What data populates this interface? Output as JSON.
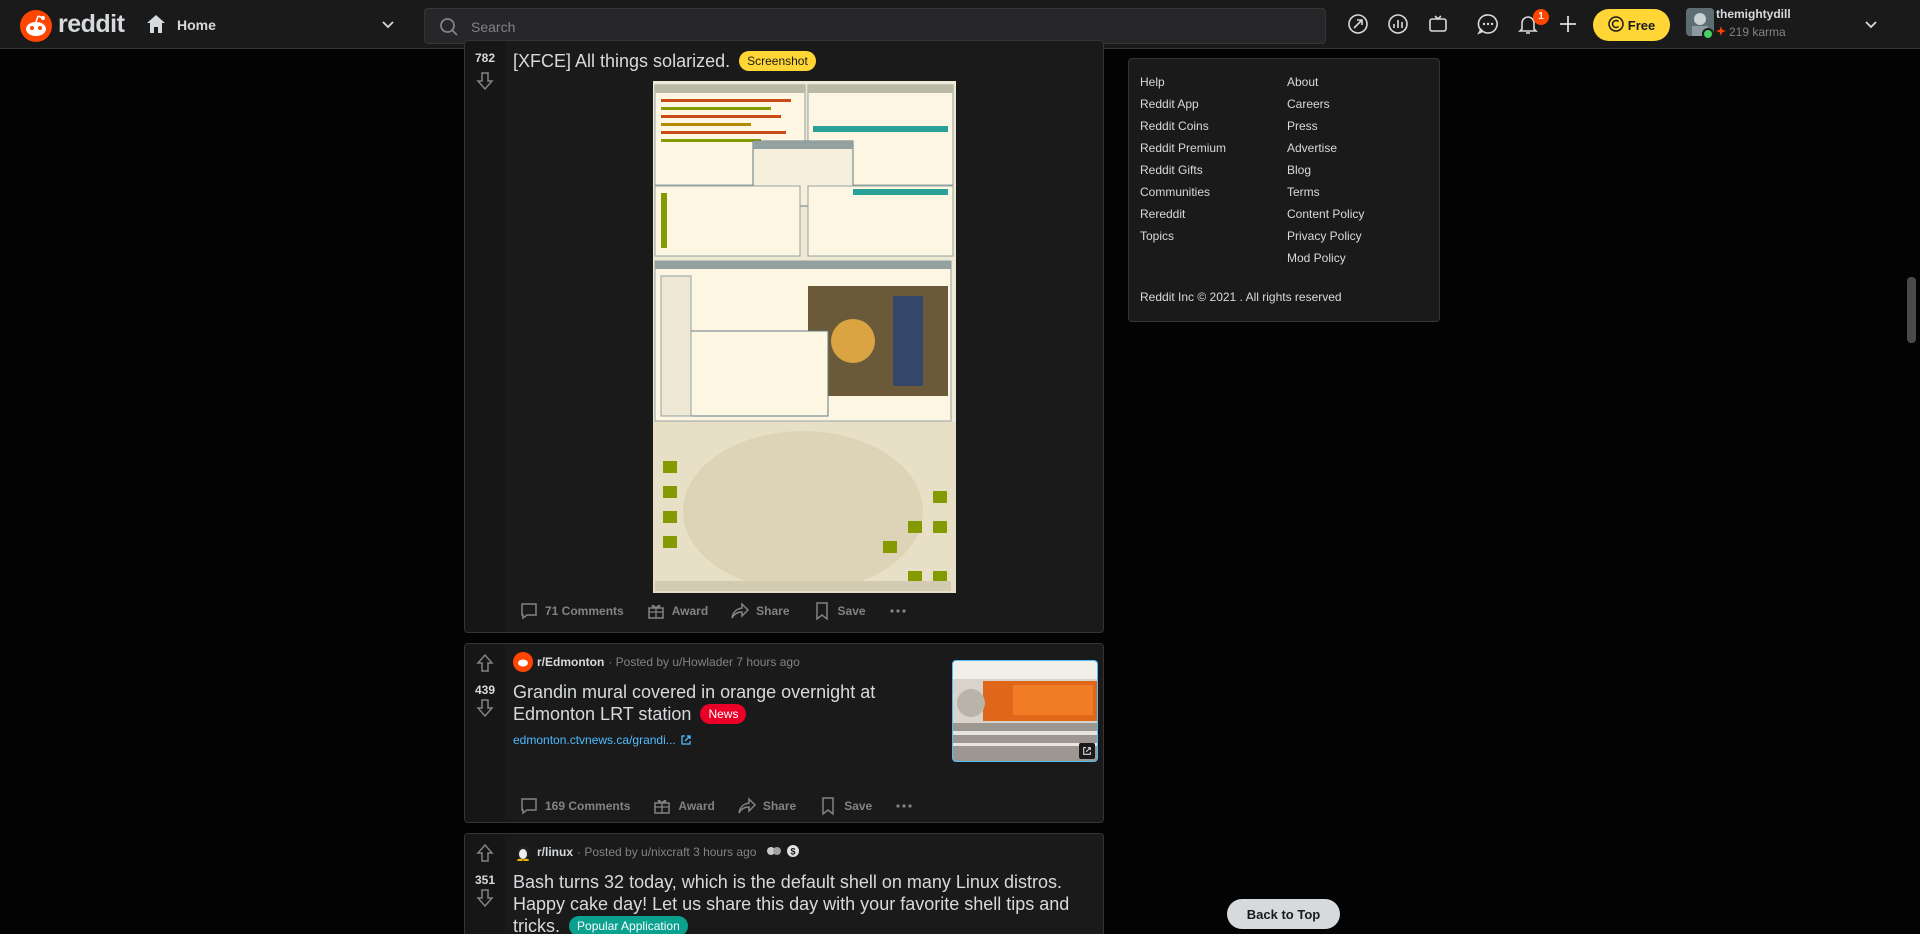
{
  "header": {
    "logo_text": "reddit",
    "home_label": "Home",
    "search_placeholder": "Search",
    "notification_count": "1",
    "free_label": "Free",
    "username": "themightydill",
    "karma": "219 karma"
  },
  "posts": [
    {
      "score": "782",
      "title": "[XFCE] All things solarized.",
      "flair": "Screenshot",
      "flair_color": "#ffd635",
      "comments": "71 Comments",
      "award": "Award",
      "share": "Share",
      "save": "Save"
    },
    {
      "score": "439",
      "subreddit": "r/Edmonton",
      "posted_by": "· Posted by u/Howlader 7 hours ago",
      "title": "Grandin mural covered in orange overnight at Edmonton LRT station",
      "flair": "News",
      "flair_color": "#ea0027",
      "link": "edmonton.ctvnews.ca/grandi...",
      "comments": "169 Comments",
      "award": "Award",
      "share": "Share",
      "save": "Save"
    },
    {
      "score": "351",
      "subreddit": "r/linux",
      "posted_by": "· Posted by u/nixcraft 3 hours ago",
      "title": "Bash turns 32 today, which is the default shell on many Linux distros. Happy cake day! Let us share this day with your favorite shell tips and tricks.",
      "flair": "Popular Application",
      "flair_color": "#0aa18f"
    }
  ],
  "sidebar": {
    "col1": [
      "Help",
      "Reddit App",
      "Reddit Coins",
      "Reddit Premium",
      "Reddit Gifts",
      "Communities",
      "Rereddit",
      "Topics"
    ],
    "col2": [
      "About",
      "Careers",
      "Press",
      "Advertise",
      "Blog",
      "Terms",
      "Content Policy",
      "Privacy Policy",
      "Mod Policy"
    ],
    "copyright": "Reddit Inc © 2021 . All rights reserved"
  },
  "back_to_top": "Back to Top",
  "colors": {
    "brand": "#ff4500",
    "bg": "#030303",
    "card": "#1a1a1b",
    "link": "#4fbcff",
    "premium": "#ffd635"
  }
}
